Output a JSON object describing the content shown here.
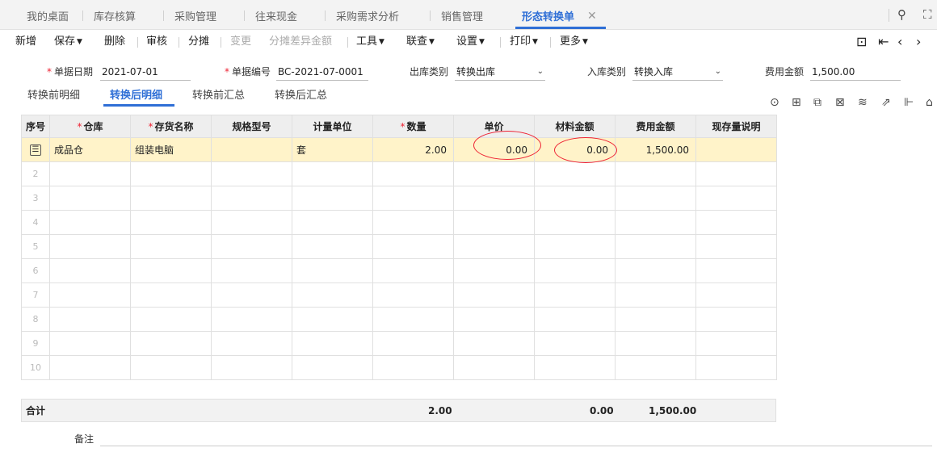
{
  "tabs": [
    {
      "label": "我的桌面"
    },
    {
      "label": "库存核算"
    },
    {
      "label": "采购管理"
    },
    {
      "label": "往来现金"
    },
    {
      "label": "采购需求分析"
    },
    {
      "label": "销售管理"
    },
    {
      "label": "形态转换单"
    }
  ],
  "toolbar": {
    "new": "新增",
    "save": "保存",
    "delete": "删除",
    "audit": "审核",
    "allocate": "分摊",
    "change": "变更",
    "allocate_diff": "分摊差异金额",
    "tools": "工具",
    "query": "联查",
    "settings": "设置",
    "print": "打印",
    "more": "更多"
  },
  "form": {
    "date_label": "单据日期",
    "date_value": "2021-07-01",
    "code_label": "单据编号",
    "code_value": "BC-2021-07-0001",
    "out_type_label": "出库类别",
    "out_type_value": "转换出库",
    "in_type_label": "入库类别",
    "in_type_value": "转换入库",
    "fee_label": "费用金额",
    "fee_value": "1,500.00"
  },
  "subtabs": [
    "转换前明细",
    "转换后明细",
    "转换前汇总",
    "转换后汇总"
  ],
  "grid": {
    "headers": {
      "idx": "序号",
      "warehouse": "仓库",
      "item": "存货名称",
      "spec": "规格型号",
      "unit": "计量单位",
      "qty": "数量",
      "price": "单价",
      "material": "材料金额",
      "fee": "费用金额",
      "stock_note": "现存量说明"
    },
    "row1": {
      "warehouse": "成品仓",
      "item": "组装电脑",
      "spec": "",
      "unit": "套",
      "qty": "2.00",
      "price": "0.00",
      "material": "0.00",
      "fee": "1,500.00",
      "stock_note": ""
    },
    "row_numbers": [
      "2",
      "3",
      "4",
      "5",
      "6",
      "7",
      "8",
      "9",
      "10"
    ]
  },
  "total": {
    "label": "合计",
    "qty": "2.00",
    "material": "0.00",
    "fee": "1,500.00"
  },
  "remark_label": "备注"
}
